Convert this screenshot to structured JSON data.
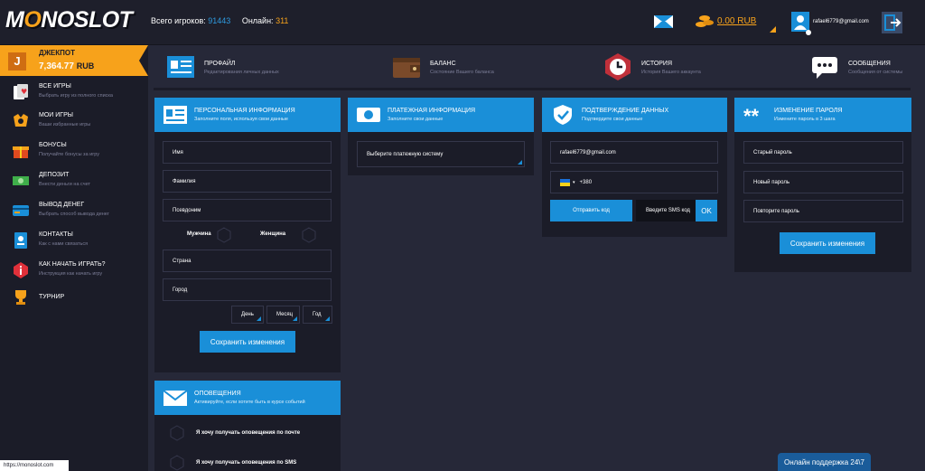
{
  "header": {
    "logo": {
      "prefix": "M",
      "o": "O",
      "rest": "NOSLOT"
    },
    "players_label": "Всего игроков:",
    "players_value": "91443",
    "online_label": "Онлайн:",
    "online_value": "311",
    "balance": "0.00 RUB",
    "email": "rafael6779@gmail.com"
  },
  "sidebar": {
    "jackpot": {
      "letter": "J",
      "label": "ДЖЕКПОТ",
      "amount": "7,364.77",
      "currency": "RUB"
    },
    "items": [
      {
        "label": "ВСЕ ИГРЫ",
        "sub": "Выбрать игру из полного списка",
        "icon": "cards-icon"
      },
      {
        "label": "МОИ ИГРЫ",
        "sub": "Ваши избранные игры",
        "icon": "favorite-icon"
      },
      {
        "label": "БОНУСЫ",
        "sub": "Получайте бонусы за игру",
        "icon": "gift-icon"
      },
      {
        "label": "ДЕПОЗИТ",
        "sub": "Внести деньги на счет",
        "icon": "cash-icon"
      },
      {
        "label": "ВЫВОД ДЕНЕГ",
        "sub": "Выбрать способ вывода денег",
        "icon": "card-icon"
      },
      {
        "label": "КОНТАКТЫ",
        "sub": "Как с нами связаться",
        "icon": "contacts-icon"
      },
      {
        "label": "КАК НАЧАТЬ ИГРАТЬ?",
        "sub": "Инструкция как начать игру",
        "icon": "info-icon"
      },
      {
        "label": "ТУРНИР",
        "sub": "",
        "icon": "trophy-icon"
      }
    ]
  },
  "tabs": [
    {
      "label": "ПРОФАЙЛ",
      "sub": "Редактирования личных данных"
    },
    {
      "label": "БАЛАНС",
      "sub": "Состояние Вашего баланса"
    },
    {
      "label": "ИСТОРИЯ",
      "sub": "История Вашего аккаунта"
    },
    {
      "label": "СООБЩЕНИЯ",
      "sub": "Сообщения от системы"
    }
  ],
  "personal": {
    "title": "ПЕРСОНАЛЬНАЯ ИНФОРМАЦИЯ",
    "sub": "Заполните поля, используя свои данные",
    "name": "Имя",
    "surname": "Фамилия",
    "nickname": "Псевдоним",
    "male": "Мужчина",
    "female": "Женщина",
    "country": "Страна",
    "city": "Город",
    "day": "День",
    "month": "Месяц",
    "year": "Год",
    "save": "Сохранить изменения"
  },
  "payment": {
    "title": "ПЛАТЕЖНАЯ ИНФОРМАЦИЯ",
    "sub": "Заполните свои данные",
    "select": "Выберите платежную систему"
  },
  "verify": {
    "title": "ПОДТВЕРЖДЕНИЕ ДАННЫХ",
    "sub": "Подтвердите свои данные",
    "email": "rafael6779@gmail.com",
    "phone_code": "+380",
    "send_code": "Отправить код",
    "sms_placeholder": "Введите SMS код",
    "ok": "OK"
  },
  "password": {
    "title": "ИЗМЕНЕНИЕ ПАРОЛЯ",
    "sub": "Измените пароль в 3 шага",
    "old": "Старый пароль",
    "new": "Новый пароль",
    "repeat": "Повторите пароль",
    "save": "Сохранить изменения"
  },
  "notify": {
    "title": "ОПОВЕЩЕНИЯ",
    "sub": "Активируйте, если хотите быть в курсе событий",
    "by_email": "Я хочу получать оповещения по почте",
    "by_sms": "Я хочу получать оповещения по SMS"
  },
  "status_url": "https://monoslot.com",
  "support": "Онлайн поддержка 24\\7",
  "colors": {
    "accent": "#1a8fd8",
    "orange": "#f7a21b",
    "panel": "#1b1c28",
    "bg": "#262838"
  }
}
